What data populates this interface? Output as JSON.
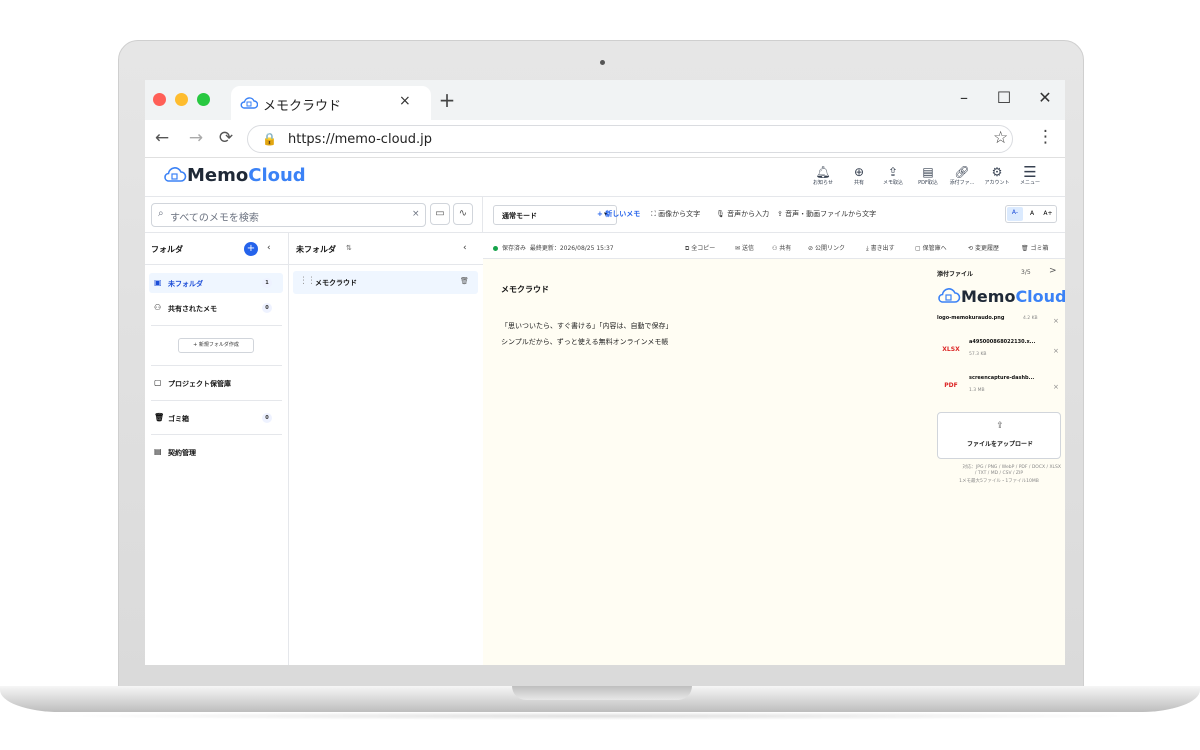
{
  "browser": {
    "tab_title": "メモクラウド",
    "tab_close": "×",
    "new_tab": "+",
    "url": "https://memo-cloud.jp",
    "window_controls": [
      "–",
      "☐",
      "✕"
    ]
  },
  "app": {
    "logo_main": "Memo",
    "logo_accent": "Cloud",
    "header_icons": [
      {
        "icon": "bell-icon",
        "label": "お知らせ"
      },
      {
        "icon": "share-icon",
        "label": "共有"
      },
      {
        "icon": "import-icon",
        "label": "メモ取込"
      },
      {
        "icon": "pdf-icon",
        "label": "PDF取込"
      },
      {
        "icon": "attachment-icon",
        "label": "添付ファ..."
      },
      {
        "icon": "gear-icon",
        "label": "アカウント"
      },
      {
        "icon": "menu-icon",
        "label": "メニュー"
      }
    ]
  },
  "search": {
    "placeholder": "すべてのメモを検索",
    "clear": "×"
  },
  "toolbar": {
    "mode": "通常モード",
    "new_memo": "+ 新しいメモ",
    "image_to_text": "画像から文字",
    "voice_input": "音声から入力",
    "audio_to_text": "音声・動画ファイルから文字",
    "font_sizes": [
      "A-",
      "A",
      "A+"
    ]
  },
  "sidebar": {
    "title": "フォルダ",
    "items": [
      {
        "label": "未フォルダ",
        "count": "1"
      },
      {
        "label": "共有されたメモ",
        "count": "0"
      }
    ],
    "new_folder": "+ 新規フォルダ作成",
    "project": "プロジェクト保管庫",
    "trash": {
      "label": "ゴミ箱",
      "count": "0"
    },
    "contract": "契約管理"
  },
  "memolist": {
    "title": "未フォルダ",
    "sort": "⇅",
    "memos": [
      {
        "title": "メモクラウド"
      }
    ]
  },
  "editor": {
    "status": "保存済み",
    "last_updated": "最終更新：2026/08/25 15:37",
    "actions": [
      "全コピー",
      "送信",
      "共有",
      "公開リンク",
      "書き出す",
      "保管庫へ",
      "変更履歴",
      "ゴミ箱"
    ],
    "memo_title": "メモクラウド",
    "lines": [
      "「思いついたら、すぐ書ける」「内容は、自動で保存」",
      "シンプルだから、ずっと使える無料オンラインメモ帳"
    ]
  },
  "attachments": {
    "title": "添付ファイル",
    "count": "3/5",
    "next": ">",
    "files": [
      {
        "name": "logo-memokuraudo.png",
        "size": "4.2 KB",
        "type": ""
      },
      {
        "name": "a495000868022130.x...",
        "size": "57.3 KB",
        "type": "XLSX"
      },
      {
        "name": "screencapture-dashb...",
        "size": "1.3 MB",
        "type": "PDF"
      }
    ],
    "upload_label": "ファイルをアップロード",
    "formats_line1": "対応：JPG / PNG / WebP / PDF / DOCX / XLSX",
    "formats_line2": "/ TXT / MD / CSV / ZIP",
    "formats_line3": "1メモ最大5ファイル・1ファイル10MB"
  }
}
